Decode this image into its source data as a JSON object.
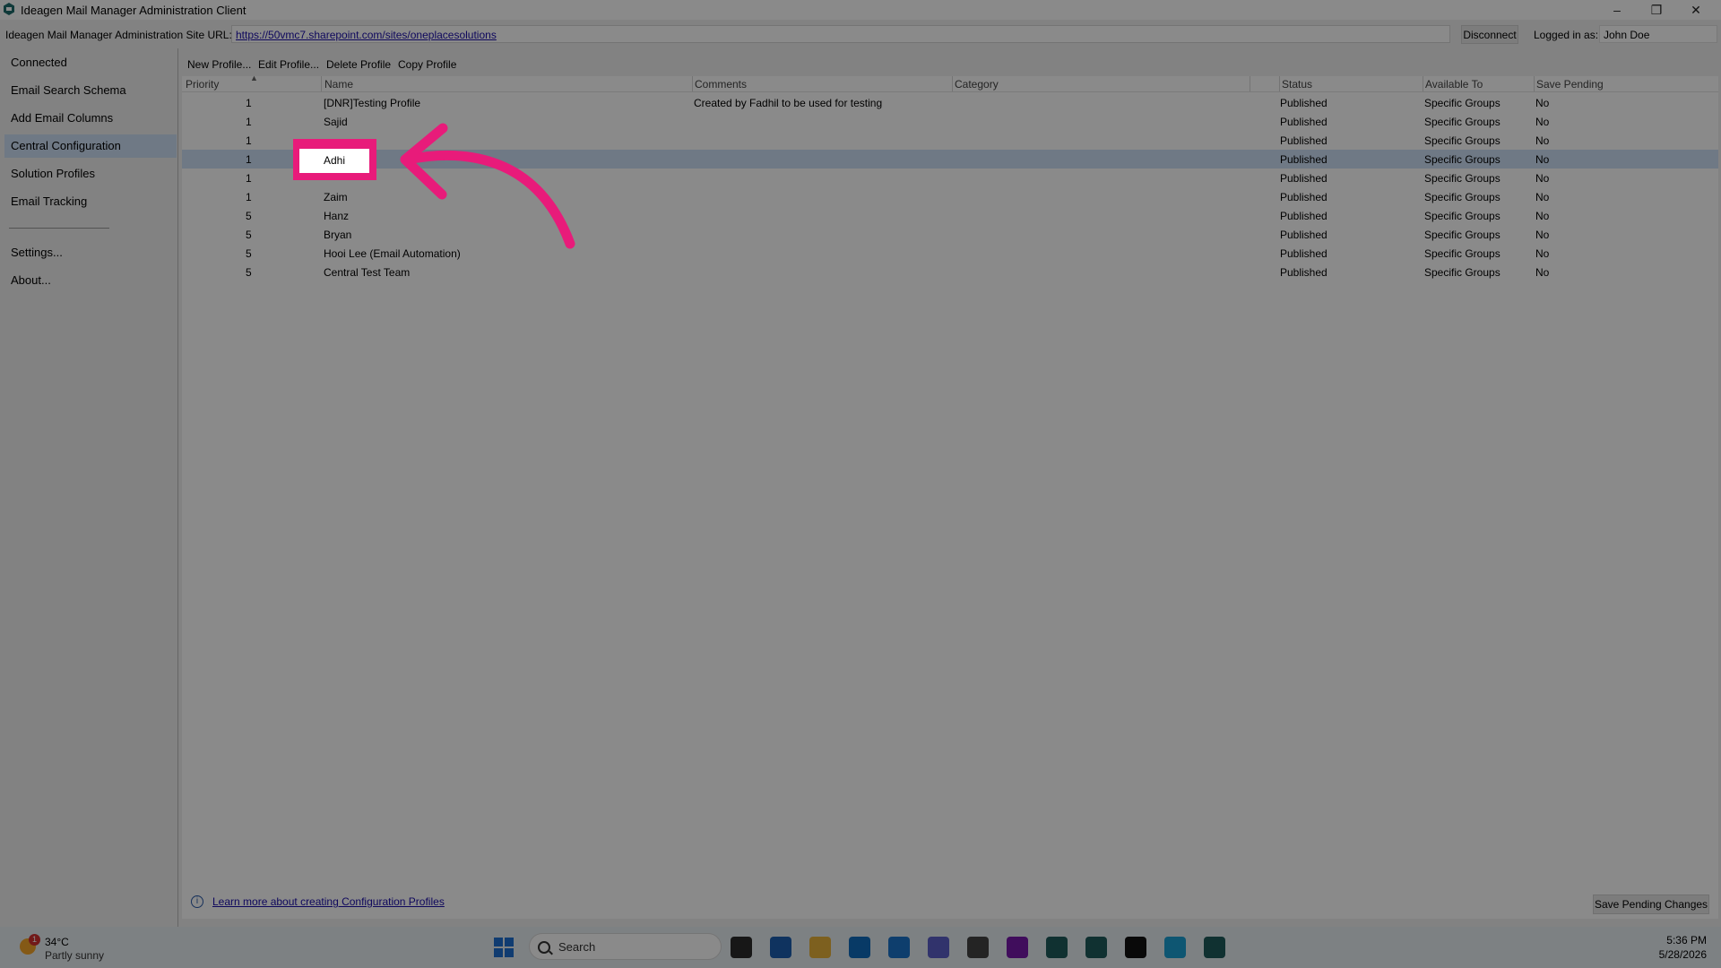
{
  "window": {
    "title": "Ideagen Mail Manager Administration Client",
    "app_icon": "ideagen-icon"
  },
  "urlbar": {
    "label": "Ideagen Mail Manager Administration Site URL:",
    "url": "https://50vmc7.sharepoint.com/sites/oneplacesolutions",
    "disconnect": "Disconnect",
    "logged_label": "Logged in as:",
    "user": "John  Doe"
  },
  "sidebar": {
    "items": [
      {
        "label": "Connected"
      },
      {
        "label": "Email Search Schema"
      },
      {
        "label": "Add Email Columns"
      },
      {
        "label": "Central Configuration",
        "selected": true
      },
      {
        "label": "Solution Profiles"
      },
      {
        "label": "Email Tracking"
      },
      {
        "label": "Settings..."
      },
      {
        "label": "About..."
      }
    ]
  },
  "toolbar": {
    "new": "New Profile...",
    "edit": "Edit Profile...",
    "delete": "Delete Profile",
    "copy": "Copy Profile"
  },
  "table": {
    "columns": [
      "Priority",
      "Name",
      "Comments",
      "Category",
      "Status",
      "Available To",
      "Save Pending"
    ],
    "rows": [
      {
        "priority": "1",
        "name": "[DNR]Testing Profile",
        "comments": "Created by Fadhil to be used for testing",
        "category": "",
        "status": "Published",
        "available": "Specific Groups",
        "pending": "No"
      },
      {
        "priority": "1",
        "name": "Sajid",
        "comments": "",
        "category": "",
        "status": "Published",
        "available": "Specific Groups",
        "pending": "No"
      },
      {
        "priority": "1",
        "name": "",
        "comments": "",
        "category": "",
        "status": "Published",
        "available": "Specific Groups",
        "pending": "No"
      },
      {
        "priority": "1",
        "name": "Adhi",
        "comments": "",
        "category": "",
        "status": "Published",
        "available": "Specific Groups",
        "pending": "No",
        "selected": true
      },
      {
        "priority": "1",
        "name": "",
        "comments": "",
        "category": "",
        "status": "Published",
        "available": "Specific Groups",
        "pending": "No"
      },
      {
        "priority": "1",
        "name": "Zaim",
        "comments": "",
        "category": "",
        "status": "Published",
        "available": "Specific Groups",
        "pending": "No"
      },
      {
        "priority": "5",
        "name": "Hanz",
        "comments": "",
        "category": "",
        "status": "Published",
        "available": "Specific Groups",
        "pending": "No"
      },
      {
        "priority": "5",
        "name": "Bryan",
        "comments": "",
        "category": "",
        "status": "Published",
        "available": "Specific Groups",
        "pending": "No"
      },
      {
        "priority": "5",
        "name": "Hooi Lee (Email Automation)",
        "comments": "",
        "category": "",
        "status": "Published",
        "available": "Specific Groups",
        "pending": "No"
      },
      {
        "priority": "5",
        "name": "Central Test Team",
        "comments": "",
        "category": "",
        "status": "Published",
        "available": "Specific Groups",
        "pending": "No"
      }
    ]
  },
  "footer": {
    "link": "Learn more about creating Configuration Profiles",
    "save": "Save Pending Changes"
  },
  "taskbar": {
    "weather_temp": "34°C",
    "weather_cond": "Partly sunny",
    "weather_badge": "1",
    "search_placeholder": "Search",
    "time": "5:36 PM",
    "date": "5/28/2026",
    "apps": [
      {
        "name": "file-explorer-dark-icon",
        "color": "#2b2b2b"
      },
      {
        "name": "store-icon",
        "color": "#1c5fb0"
      },
      {
        "name": "folder-icon",
        "color": "#e8b23a"
      },
      {
        "name": "outlook-icon",
        "color": "#0f6cbd"
      },
      {
        "name": "outlook-classic-icon",
        "color": "#1a73c9"
      },
      {
        "name": "teams-icon",
        "color": "#5b5fc7"
      },
      {
        "name": "copilot-icon",
        "color": "#444444"
      },
      {
        "name": "onenote-icon",
        "color": "#7719aa"
      },
      {
        "name": "ideagen-app-icon",
        "color": "#1e5b5b"
      },
      {
        "name": "ideagen-app2-icon",
        "color": "#1e5b5b"
      },
      {
        "name": "terminal-icon",
        "color": "#111111"
      },
      {
        "name": "edge-icon",
        "color": "#1b9fd3"
      },
      {
        "name": "ideagen-app3-icon",
        "color": "#1e5b5b"
      }
    ]
  },
  "colors": {
    "accent": "#e81b7a",
    "selection": "#cde0f5",
    "link": "#1a0dab"
  }
}
